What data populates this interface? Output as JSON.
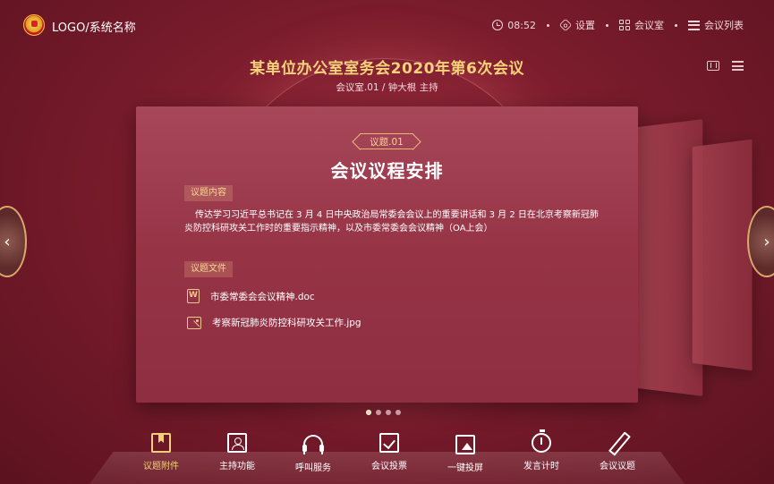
{
  "header": {
    "system_name": "LOGO/系统名称",
    "time": "08:52",
    "settings_label": "设置",
    "room_label": "会议室",
    "meeting_list_label": "会议列表"
  },
  "meeting": {
    "title": "某单位办公室室务会2020年第6次会议",
    "subtitle": "会议室.01 / 钟大根 主持"
  },
  "agenda": {
    "tag": "议题.01",
    "title": "会议议程安排",
    "content_label": "议题内容",
    "content": "传达学习习近平总书记在 3 月 4 日中央政治局常委会会议上的重要讲话和 3 月 2 日在北京考察新冠肺炎防控科研攻关工作时的重要指示精神，以及市委常委会会议精神（OA上会）",
    "files_label": "议题文件",
    "files": [
      {
        "name": "市委常委会会议精神.doc",
        "icon": "word-file-icon"
      },
      {
        "name": "考察新冠肺炎防控科研攻关工作.jpg",
        "icon": "image-file-icon"
      }
    ]
  },
  "pager": {
    "total": 4,
    "current": 1
  },
  "toolbar": {
    "items": [
      {
        "label": "议题附件",
        "icon": "bookmark-icon",
        "active": true
      },
      {
        "label": "主持功能",
        "icon": "host-icon",
        "active": false
      },
      {
        "label": "呼叫服务",
        "icon": "headset-icon",
        "active": false
      },
      {
        "label": "会议投票",
        "icon": "vote-icon",
        "active": false
      },
      {
        "label": "一键投屏",
        "icon": "screen-cast-icon",
        "active": false
      },
      {
        "label": "发言计时",
        "icon": "stopwatch-icon",
        "active": false
      },
      {
        "label": "会议议题",
        "icon": "pen-icon",
        "active": false
      }
    ]
  },
  "colors": {
    "background": "#7a1c2c",
    "accent_gold": "#f7d27a",
    "card": "#963446"
  }
}
